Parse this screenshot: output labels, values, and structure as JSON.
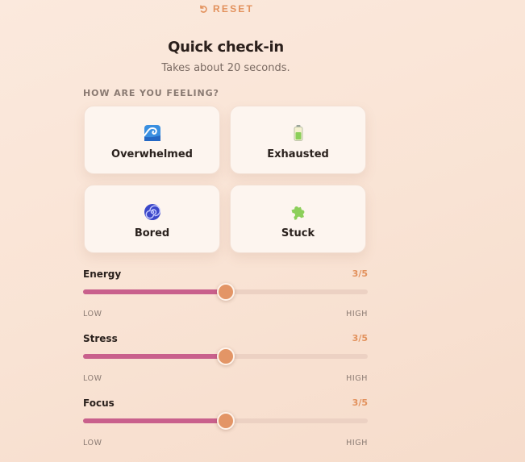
{
  "header": {
    "reset_label": "RESET",
    "reset_icon": "reset-icon"
  },
  "checkin": {
    "title": "Quick check-in",
    "subtitle": "Takes about 20 seconds."
  },
  "feelings": {
    "section_label": "HOW ARE YOU FEELING?",
    "options": [
      {
        "label": "Overwhelmed",
        "icon": "wave-icon"
      },
      {
        "label": "Exhausted",
        "icon": "low-battery-icon"
      },
      {
        "label": "Bored",
        "icon": "spiral-icon"
      },
      {
        "label": "Stuck",
        "icon": "puzzle-icon"
      }
    ]
  },
  "sliders": [
    {
      "label": "Energy",
      "value_text": "3/5",
      "value": 3,
      "max": 5,
      "low_label": "LOW",
      "high_label": "HIGH"
    },
    {
      "label": "Stress",
      "value_text": "3/5",
      "value": 3,
      "max": 5,
      "low_label": "LOW",
      "high_label": "HIGH"
    },
    {
      "label": "Focus",
      "value_text": "3/5",
      "value": 3,
      "max": 5,
      "low_label": "LOW",
      "high_label": "HIGH"
    }
  ],
  "colors": {
    "accent_orange": "#e2915c",
    "slider_fill": "#c9608c",
    "slider_track": "#ecd1c3",
    "slider_thumb": "#e39566",
    "background": "#fbe9dd",
    "card_background": "#fdf5ef"
  }
}
